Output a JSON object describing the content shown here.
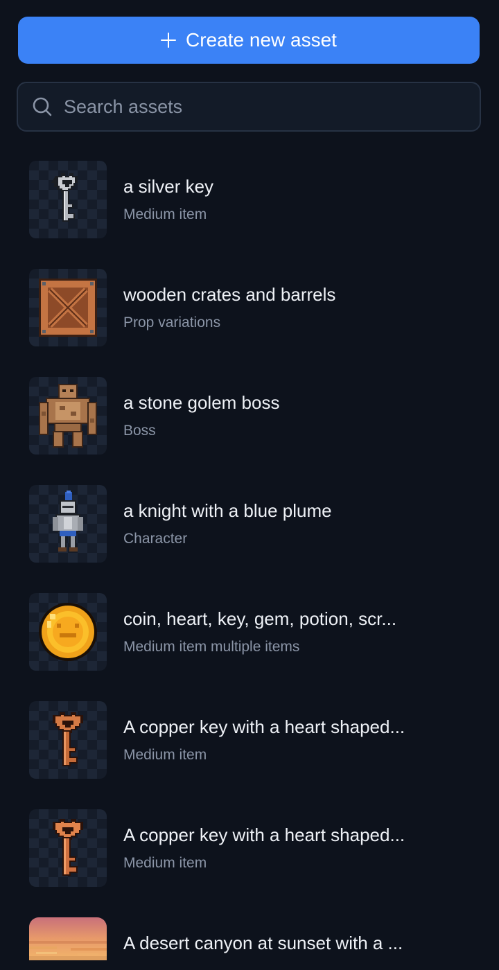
{
  "create_button": {
    "label": "Create new asset",
    "icon": "plus-icon"
  },
  "search": {
    "placeholder": "Search assets",
    "value": "",
    "icon": "search-icon"
  },
  "assets": [
    {
      "title": "a silver key",
      "subtitle": "Medium item",
      "thumbnail": "silver-key"
    },
    {
      "title": "wooden crates and barrels",
      "subtitle": "Prop variations",
      "thumbnail": "wooden-crate"
    },
    {
      "title": "a stone golem boss",
      "subtitle": "Boss",
      "thumbnail": "stone-golem"
    },
    {
      "title": "a knight with a blue plume",
      "subtitle": "Character",
      "thumbnail": "knight"
    },
    {
      "title": "coin, heart, key, gem, potion, scr...",
      "subtitle": "Medium item multiple items",
      "thumbnail": "gold-coin"
    },
    {
      "title": "A copper key with a heart shaped...",
      "subtitle": "Medium item",
      "thumbnail": "copper-key"
    },
    {
      "title": "A copper key with a heart shaped...",
      "subtitle": "Medium item",
      "thumbnail": "copper-key"
    },
    {
      "title": "A desert canyon at sunset with a ...",
      "subtitle": "",
      "thumbnail": "desert-canyon"
    }
  ],
  "colors": {
    "background": "#0d121c",
    "accent": "#3b82f6",
    "search_bg": "#131b28",
    "muted_text": "#8b95a7"
  }
}
